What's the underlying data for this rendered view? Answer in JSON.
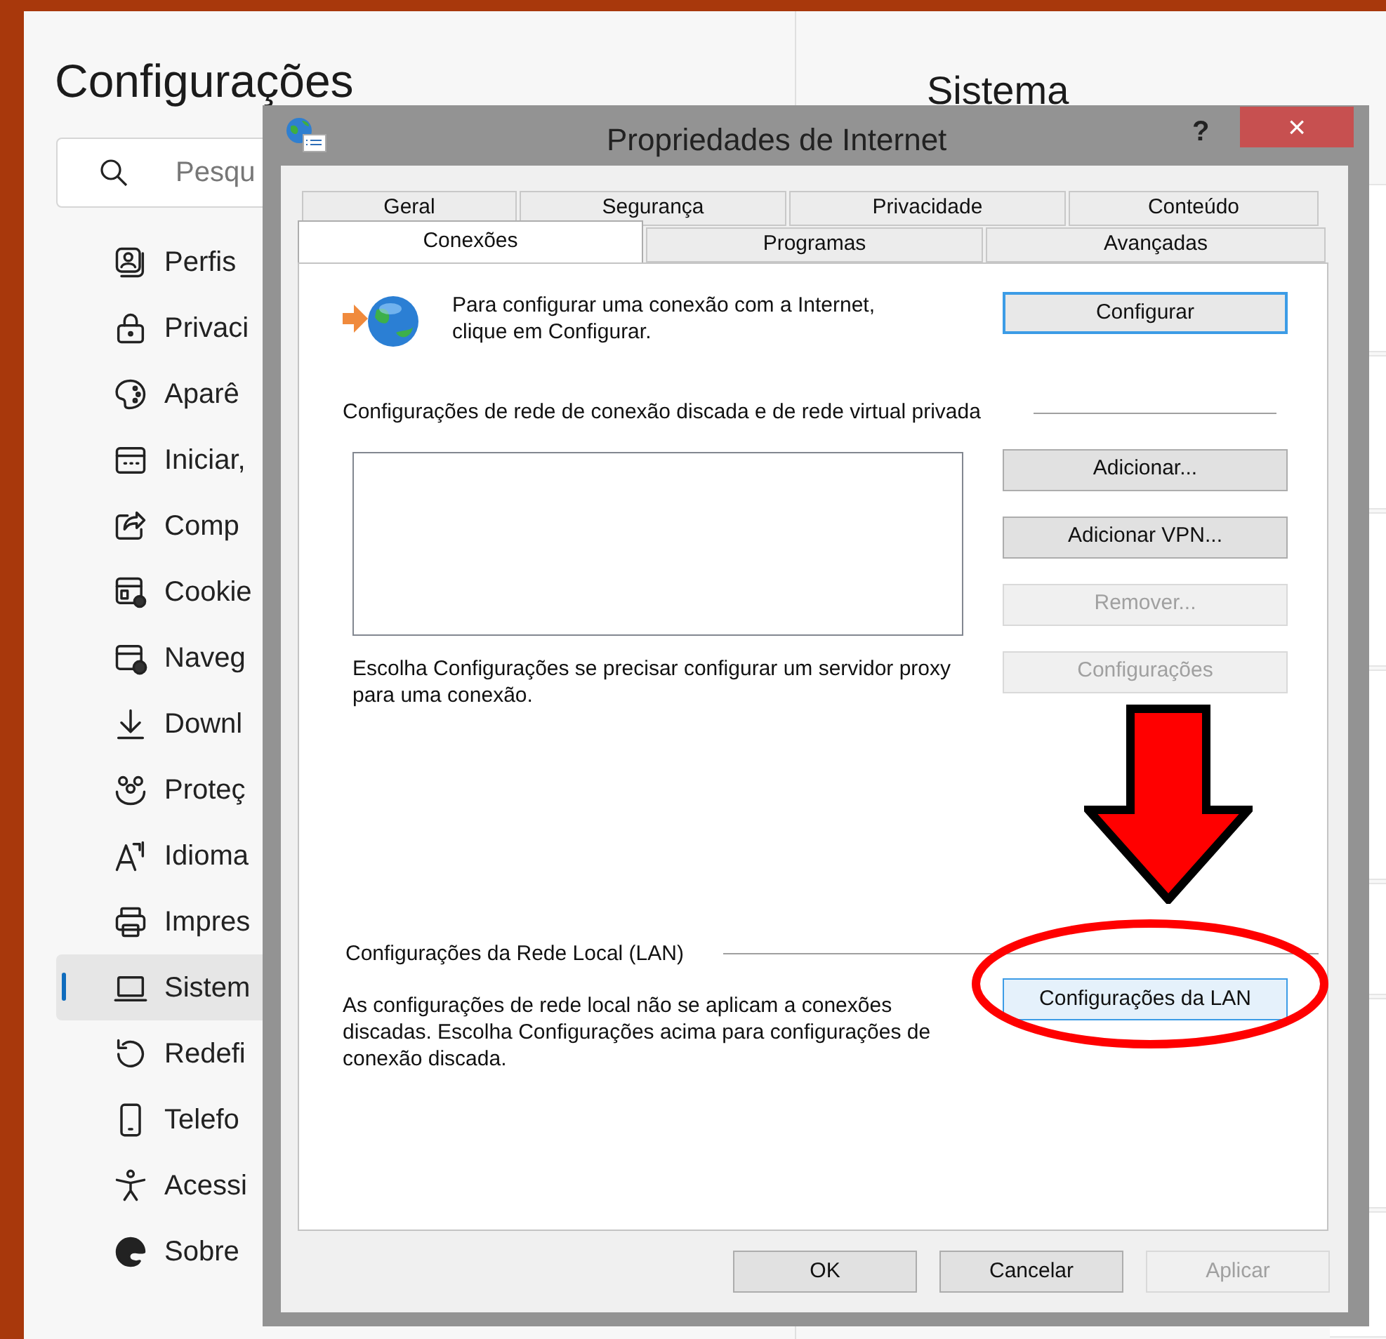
{
  "settings": {
    "title": "Configurações",
    "search": {
      "placeholder": "Pesqu"
    },
    "nav_items": [
      {
        "label": "Perfis",
        "selected": false
      },
      {
        "label": "Privaci",
        "selected": false
      },
      {
        "label": "Aparê",
        "selected": false
      },
      {
        "label": "Iniciar,",
        "selected": false
      },
      {
        "label": "Comp",
        "selected": false
      },
      {
        "label": "Cookie",
        "selected": false
      },
      {
        "label": "Naveg",
        "selected": false
      },
      {
        "label": "Downl",
        "selected": false
      },
      {
        "label": "Proteç",
        "selected": false
      },
      {
        "label": "Idioma",
        "selected": false
      },
      {
        "label": "Impres",
        "selected": false
      },
      {
        "label": "Sistem",
        "selected": true
      },
      {
        "label": "Redefi",
        "selected": false
      },
      {
        "label": "Telefo",
        "selected": false
      },
      {
        "label": "Acessi",
        "selected": false
      },
      {
        "label": "Sobre",
        "selected": false
      }
    ],
    "page_title": "Sistema"
  },
  "dialog": {
    "title": "Propriedades de Internet",
    "help": "?",
    "close": "×",
    "tab_rows": [
      [
        {
          "label": "Geral",
          "selected": false
        },
        {
          "label": "Segurança",
          "selected": false
        },
        {
          "label": "Privacidade",
          "selected": false
        },
        {
          "label": "Conteúdo",
          "selected": false
        }
      ],
      [
        {
          "label": "Conexões",
          "selected": true
        },
        {
          "label": "Programas",
          "selected": false
        },
        {
          "label": "Avançadas",
          "selected": false
        }
      ]
    ],
    "setup_text": "Para configurar uma conexão com a Internet, clique em Configurar.",
    "setup_button": {
      "label": "Configurar",
      "focused": true,
      "disabled": false
    },
    "dialup_heading": "Configurações de rede de conexão discada e de rede virtual privada",
    "dialup_buttons": [
      {
        "label": "Adicionar...",
        "disabled": false
      },
      {
        "label": "Adicionar VPN...",
        "disabled": false
      },
      {
        "label": "Remover...",
        "disabled": true
      }
    ],
    "proxy_text": "Escolha Configurações se precisar configurar um servidor proxy para uma conexão.",
    "proxy_button": {
      "label": "Configurações",
      "disabled": true
    },
    "lan_heading": "Configurações da Rede Local (LAN)",
    "lan_text": "As configurações de rede local não se aplicam a conexões discadas. Escolha Configurações acima para configurações de conexão discada.",
    "lan_button": {
      "label": "Configurações da LAN",
      "hovered": true
    },
    "footer_buttons": [
      {
        "label": "OK",
        "disabled": false
      },
      {
        "label": "Cancelar",
        "disabled": false
      },
      {
        "label": "Aplicar",
        "disabled": true
      }
    ]
  },
  "annotations": [
    {
      "kind": "arrow"
    },
    {
      "kind": "ellipse"
    }
  ]
}
